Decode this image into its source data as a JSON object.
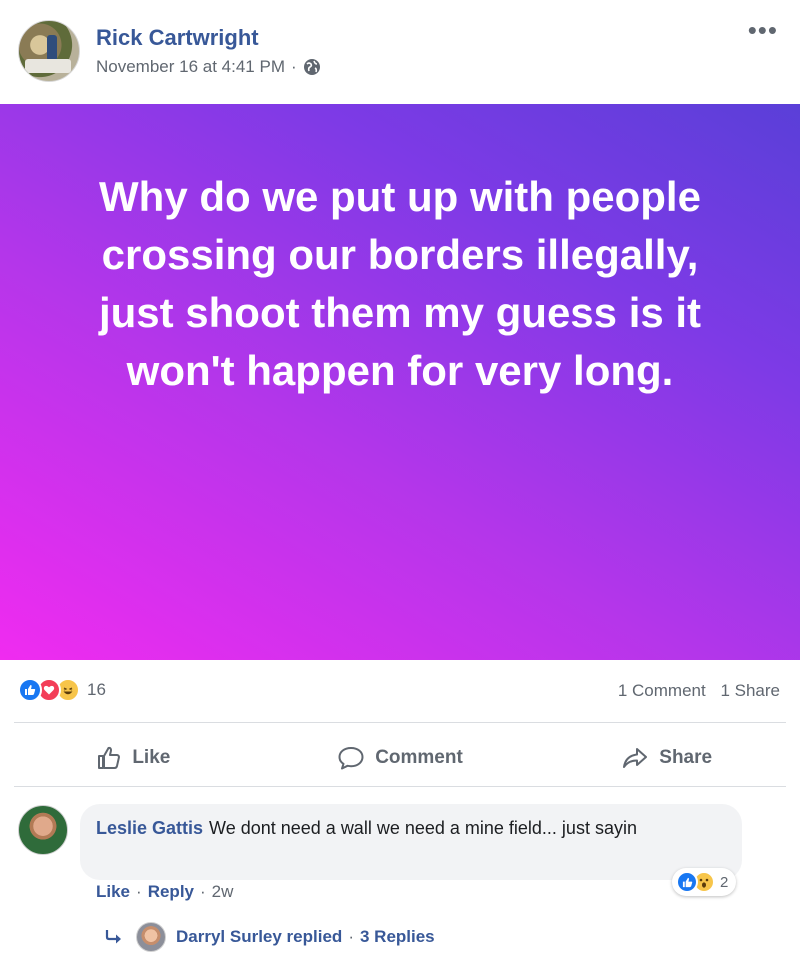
{
  "post": {
    "author": "Rick Cartwright",
    "timestamp": "November 16 at 4:41 PM",
    "separator": "·",
    "privacy_icon": "globe-icon",
    "more_icon": "more-options-icon",
    "body_text": "Why do we put up with people\ncrossing our borders illegally,\njust shoot them my guess is it\nwon't happen for very long.",
    "background_gradient": [
      "#f02bf0",
      "#b436ea",
      "#7e3ae6",
      "#5a3fd8"
    ]
  },
  "stats": {
    "reaction_icons": [
      "like-reaction-icon",
      "love-reaction-icon",
      "haha-reaction-icon"
    ],
    "reaction_count": "16",
    "comments": "1 Comment",
    "shares": "1 Share"
  },
  "actions": {
    "like": "Like",
    "comment": "Comment",
    "share": "Share"
  },
  "comment": {
    "author": "Leslie Gattis",
    "text": "We dont need a wall we need a mine field... just sayin",
    "reaction_icons": [
      "like-reaction-icon",
      "wow-reaction-icon"
    ],
    "reaction_count": "2",
    "like_label": "Like",
    "reply_label": "Reply",
    "age": "2w",
    "separator": "·"
  },
  "reply": {
    "summary": "Darryl Surley replied",
    "separator": "·",
    "count": "3 Replies"
  },
  "colors": {
    "link_blue": "#385898",
    "meta_gray": "#606770",
    "like_blue": "#1877f2",
    "love_red": "#f33e58",
    "haha_yellow": "#f7c54a"
  }
}
